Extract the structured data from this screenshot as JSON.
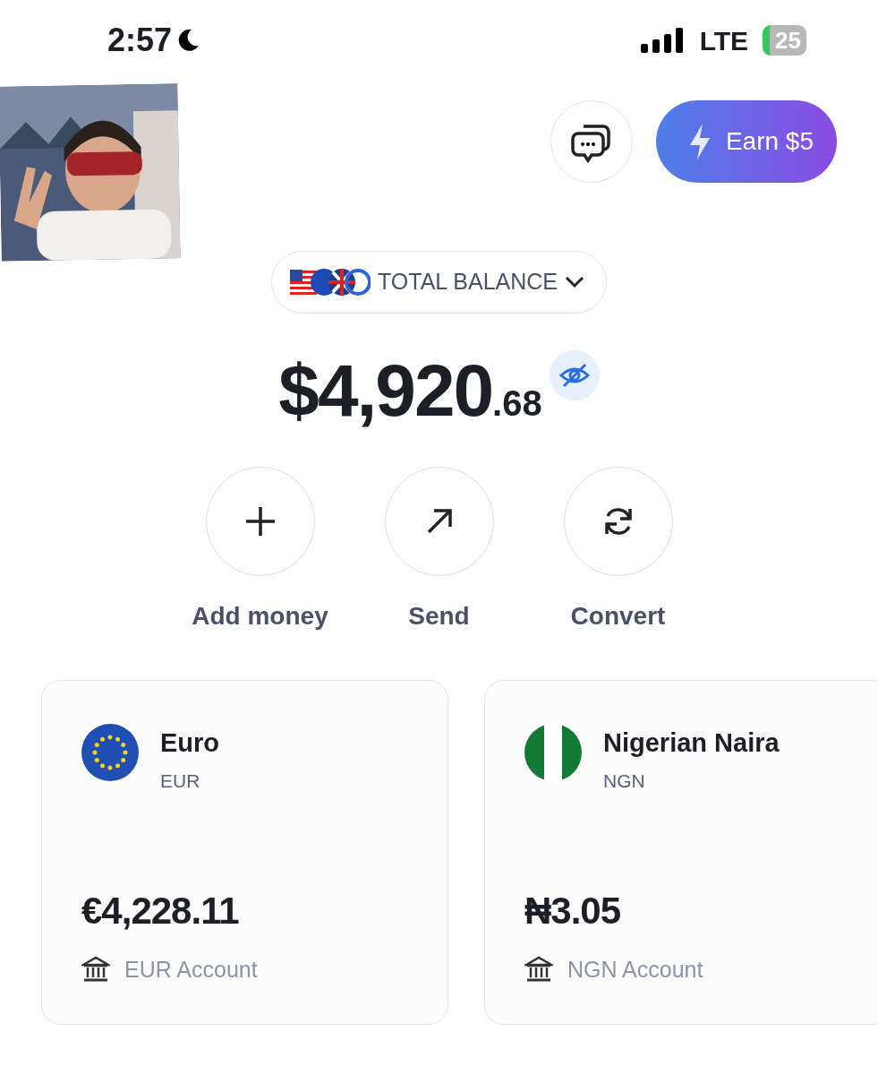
{
  "status_bar": {
    "time": "2:57",
    "network": "LTE",
    "battery": "25"
  },
  "header": {
    "earn_button": "Earn $5"
  },
  "balance": {
    "selector": "TOTAL BALANCE",
    "whole": "$4,920",
    "cents": ".68"
  },
  "actions": [
    {
      "label": "Add money",
      "kind": "add"
    },
    {
      "label": "Send",
      "kind": "send"
    },
    {
      "label": "Convert",
      "kind": "convert"
    }
  ],
  "accounts": [
    {
      "name": "Euro",
      "code": "EUR",
      "amount": "€4,228.11",
      "account": "EUR Account"
    },
    {
      "name": "Nigerian Naira",
      "code": "NGN",
      "amount": "₦3.05",
      "account": "NGN Account"
    }
  ]
}
